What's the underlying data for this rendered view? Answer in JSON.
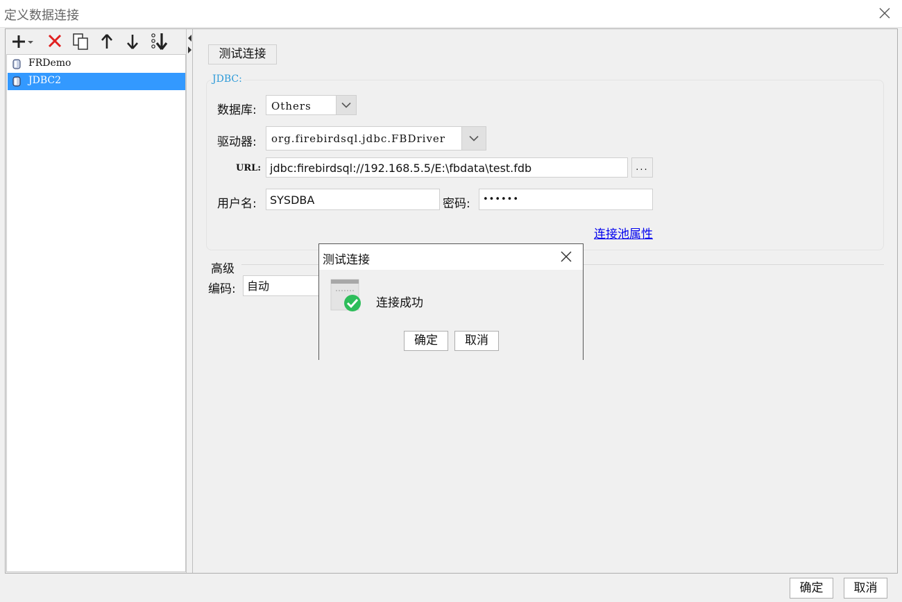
{
  "window": {
    "title": "定义数据连接"
  },
  "connection_list": {
    "items": [
      {
        "label": "FRDemo",
        "selected": false
      },
      {
        "label": "JDBC2",
        "selected": true
      }
    ]
  },
  "toolbar": {
    "icons": [
      "plus-dropdown-icon",
      "delete-x-icon",
      "copy-icon",
      "arrow-up-icon",
      "arrow-down-icon",
      "sort-icon"
    ]
  },
  "form": {
    "test_button": "测试连接",
    "group_label": "JDBC:",
    "database_label": "数据库:",
    "database_value": "Others",
    "driver_label": "驱动器:",
    "driver_value": "org.firebirdsql.jdbc.FBDriver",
    "url_label": "URL:",
    "url_value": "jdbc:firebirdsql://192.168.5.5/E:\\fbdata\\test.fdb",
    "browse_button": "...",
    "username_label": "用户名:",
    "username_value": "SYSDBA",
    "password_label": "密码:",
    "password_value": "••••••",
    "pool_link": "连接池属性",
    "advanced_label": "高级",
    "encoding_label": "编码:",
    "encoding_value": "自动"
  },
  "popup": {
    "title": "测试连接",
    "message": "连接成功",
    "ok_button": "确定",
    "cancel_button": "取消"
  },
  "footer": {
    "ok_button": "确定",
    "cancel_button": "取消"
  },
  "colors": {
    "selection": "#3399ff",
    "success": "#2dbd5a",
    "delete": "#e02020",
    "link": "#0000ee",
    "group_label": "#2c9ad8"
  }
}
